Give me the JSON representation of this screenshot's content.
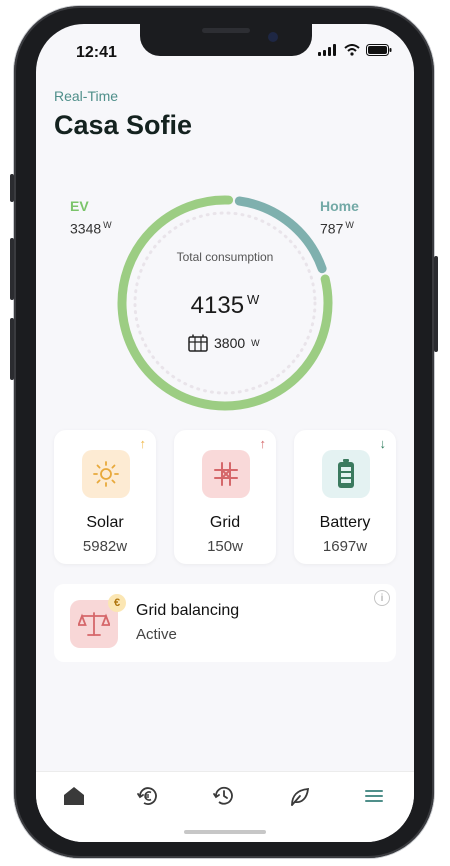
{
  "status": {
    "time": "12:41"
  },
  "header": {
    "subtitle": "Real-Time",
    "title": "Casa Sofie"
  },
  "consumption": {
    "label": "Total consumption",
    "total_value": "4135",
    "total_unit": "W",
    "solar_value": "3800",
    "solar_unit": "W",
    "ev": {
      "label": "EV",
      "value": "3348",
      "unit": "W",
      "color": "#9ccd83"
    },
    "home": {
      "label": "Home",
      "value": "787",
      "unit": "W",
      "color": "#7fb0ae"
    }
  },
  "sources": [
    {
      "name": "Solar",
      "value": "5982w",
      "arrow": "↑",
      "arrow_color": "#f0b84a",
      "icon": "sun-icon",
      "bg": "#fdebd3"
    },
    {
      "name": "Grid",
      "value": "150w",
      "arrow": "↑",
      "arrow_color": "#d5676a",
      "icon": "grid-icon",
      "bg": "#f9d9d9"
    },
    {
      "name": "Battery",
      "value": "1697w",
      "arrow": "↓",
      "arrow_color": "#2e7d5c",
      "icon": "battery-icon",
      "bg": "#e4f2f2"
    }
  ],
  "grid_balancing": {
    "title": "Grid balancing",
    "status": "Active",
    "badge_symbol": "€",
    "info_symbol": "i"
  },
  "nav": [
    "home-icon",
    "euro-cycle-icon",
    "history-icon",
    "leaf-icon",
    "menu-icon"
  ],
  "colors": {
    "accent": "#4f8f8a",
    "active_nav": "#4f8f8a"
  }
}
